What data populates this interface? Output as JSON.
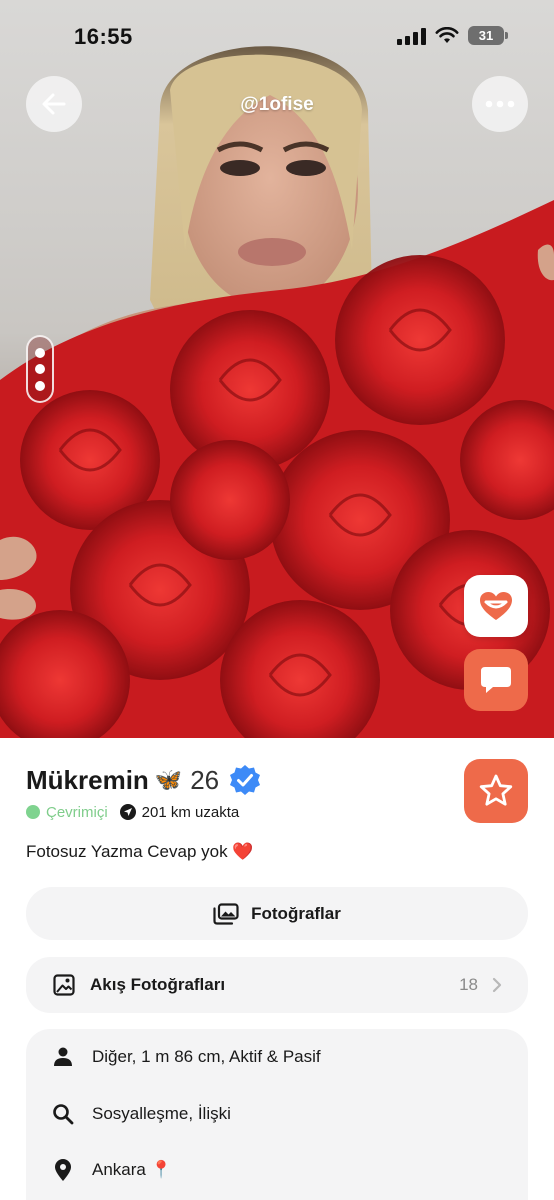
{
  "status_bar": {
    "time": "16:55",
    "battery": "31"
  },
  "header": {
    "username": "@1ofise"
  },
  "photo": {
    "page_count": 3,
    "current_page": 1
  },
  "profile": {
    "name": "Mükremin",
    "name_emoji": "🦋",
    "age": "26",
    "online_status": "Çevrimiçi",
    "distance": "201 km uzakta",
    "bio": "Fotosuz Yazma Cevap yok ❤️"
  },
  "buttons": {
    "photos_label": "Fotoğraflar",
    "feed_photos_label": "Akış Fotoğrafları",
    "feed_photos_count": "18"
  },
  "info": {
    "details": "Diğer, 1 m 86 cm, Aktif & Pasif",
    "looking_for": "Sosyalleşme, İlişki",
    "location": "Ankara 📍"
  },
  "icons": {
    "back": "arrow-left-icon",
    "more": "more-dots-icon",
    "like": "heart-smile-icon",
    "chat": "chat-bubble-icon",
    "favorite": "star-icon",
    "verified": "verified-badge-icon",
    "photos": "photos-icon",
    "feed": "feed-photos-icon",
    "person": "person-icon",
    "search": "search-icon",
    "location": "location-pin-icon"
  },
  "colors": {
    "accent": "#ee6a4a",
    "online": "#7fd38f",
    "verified": "#3d8af7",
    "card_bg": "#f4f4f5"
  }
}
